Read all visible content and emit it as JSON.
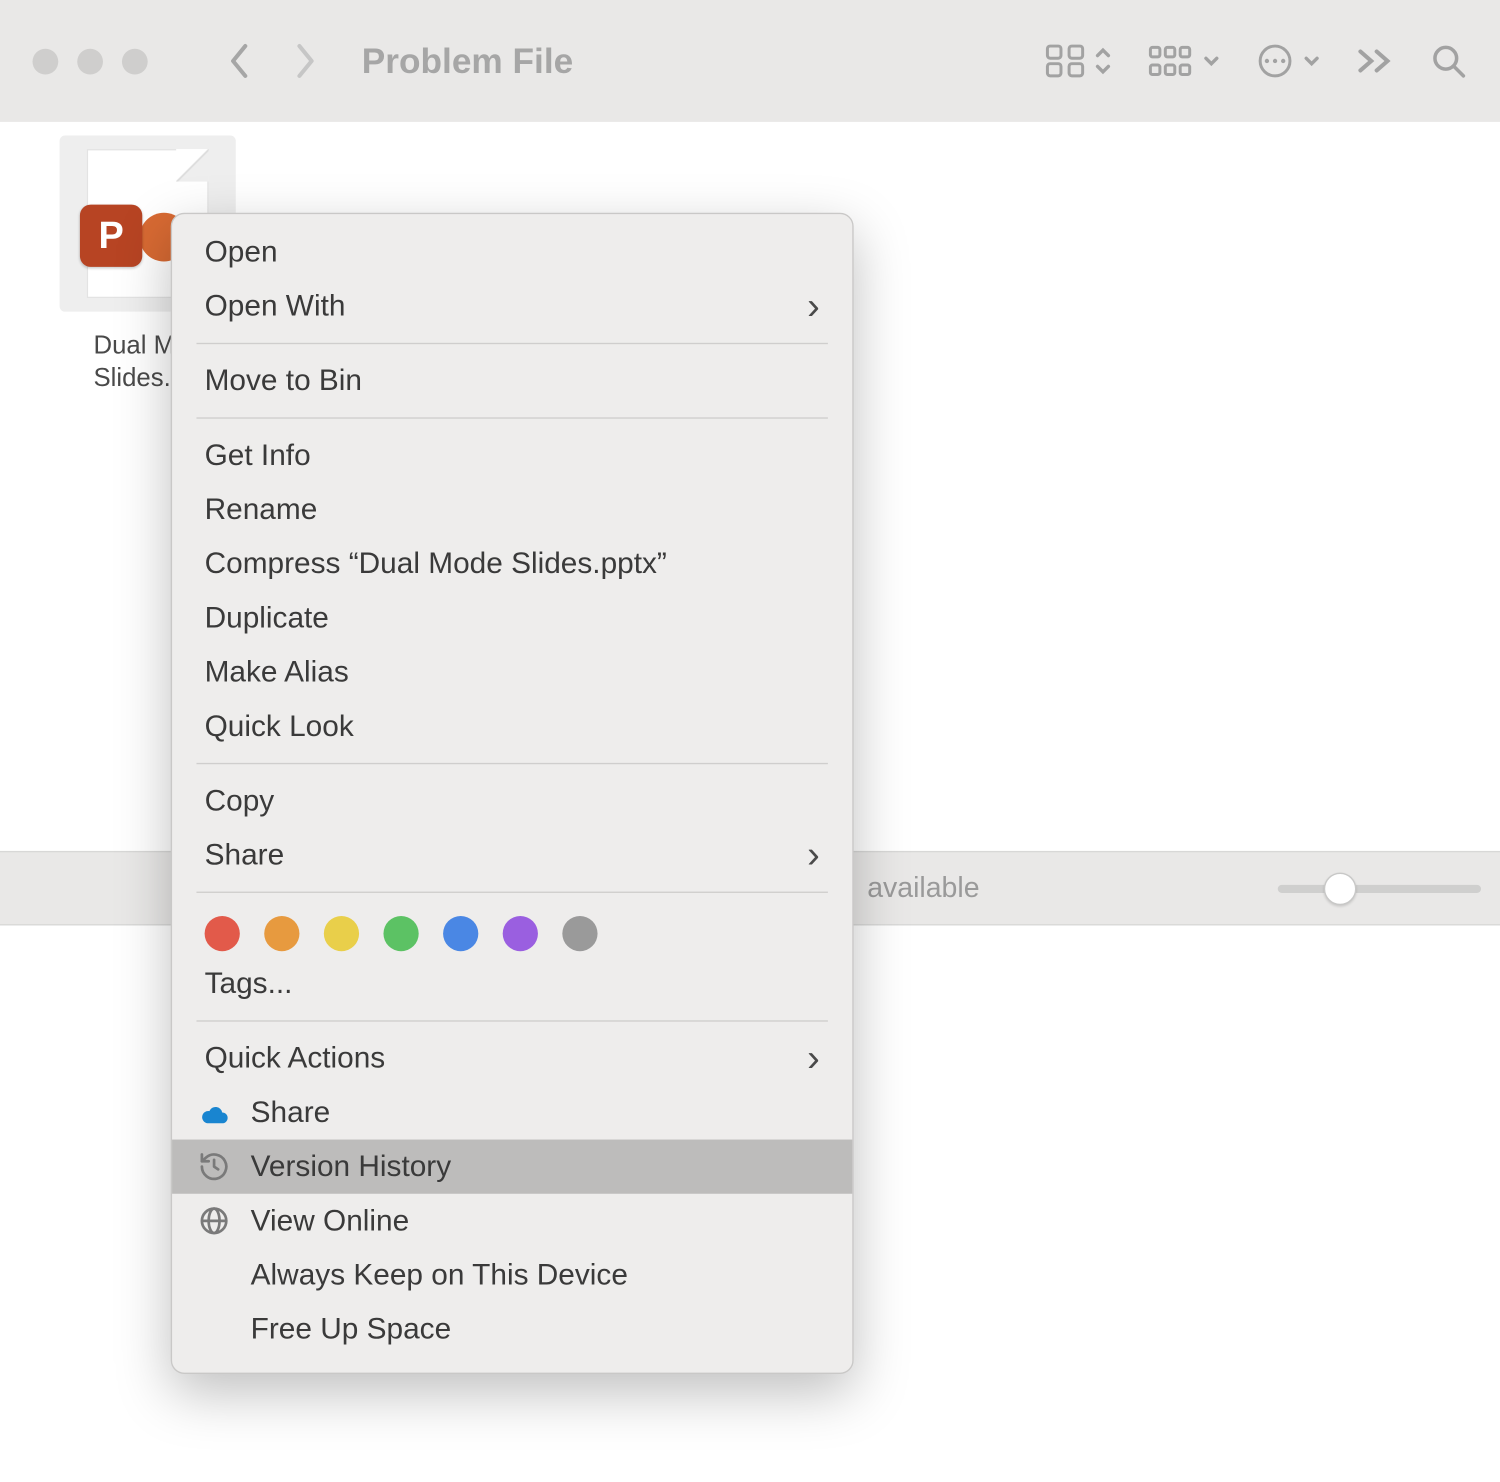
{
  "toolbar": {
    "title": "Problem File"
  },
  "file": {
    "badge_letter": "P",
    "label_line1": "Dual M",
    "label_line2": "Slides."
  },
  "statusbar": {
    "text": "available"
  },
  "context_menu": {
    "open": "Open",
    "open_with": "Open With",
    "move_to_bin": "Move to Bin",
    "get_info": "Get Info",
    "rename": "Rename",
    "compress": "Compress “Dual Mode Slides.pptx”",
    "duplicate": "Duplicate",
    "make_alias": "Make Alias",
    "quick_look": "Quick Look",
    "copy": "Copy",
    "share": "Share",
    "tags_label": "Tags...",
    "tag_colors": [
      "#e25a4a",
      "#e79a3f",
      "#e9cf4a",
      "#5cc264",
      "#4a87e4",
      "#9a5fe0",
      "#9a9a9a"
    ],
    "quick_actions": "Quick Actions",
    "qa_share": "Share",
    "qa_version_history": "Version History",
    "qa_view_online": "View Online",
    "qa_always_keep": "Always Keep on This Device",
    "qa_free_up": "Free Up Space"
  }
}
